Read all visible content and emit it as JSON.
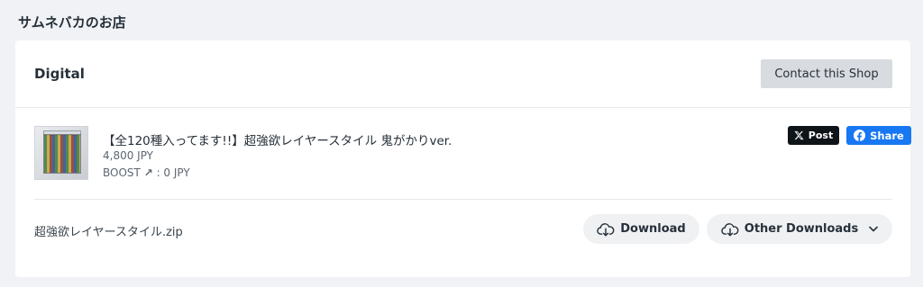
{
  "shop": {
    "name": "サムネバカのお店"
  },
  "card": {
    "title": "Digital",
    "contact_label": "Contact this Shop"
  },
  "item": {
    "title": "【全120種入ってます!!】超強欲レイヤースタイル 鬼がかりver.",
    "price": "4,800 JPY",
    "boost_label": "BOOST",
    "boost_value": " : 0 JPY",
    "share_x_label": "Post",
    "share_fb_label": "Share"
  },
  "file": {
    "name": "超強欲レイヤースタイル.zip",
    "download_label": "Download",
    "other_downloads_label": "Other Downloads"
  },
  "colors": {
    "background": "#f1f2f5",
    "card": "#ffffff",
    "contact_button": "#d8dbe0",
    "x_button": "#0f1419",
    "facebook_button": "#1877f2"
  },
  "icons": [
    "x-logo-icon",
    "facebook-icon",
    "cloud-download-icon",
    "chevron-down-icon",
    "boost-arrow-icon"
  ]
}
